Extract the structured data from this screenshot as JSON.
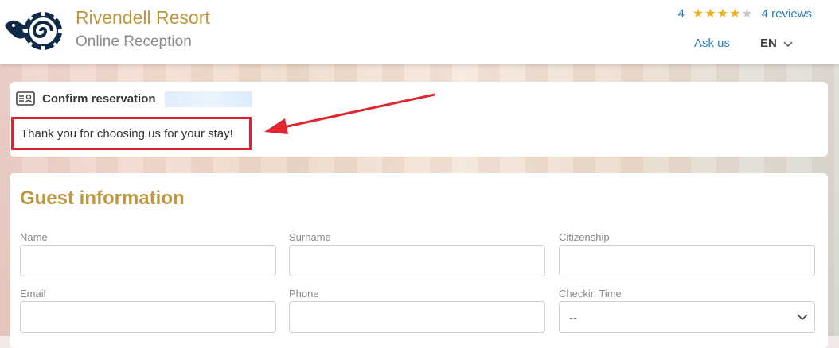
{
  "header": {
    "hotel_name": "Rivendell Resort",
    "subtitle": "Online Reception",
    "rating": "4",
    "stars_filled": 4,
    "stars_total": 5,
    "reviews_link": "4 reviews",
    "ask_us": "Ask us",
    "language": "EN",
    "logo_icon": "spiral-bird-logo-icon"
  },
  "confirm": {
    "title": "Confirm reservation",
    "message": "Thank you for choosing us for your stay!"
  },
  "guest": {
    "title": "Guest information",
    "fields": {
      "name_label": "Name",
      "surname_label": "Surname",
      "citizenship_label": "Citizenship",
      "email_label": "Email",
      "phone_label": "Phone",
      "checkin_label": "Checkin Time",
      "checkin_value": "--"
    }
  },
  "colors": {
    "brand_gold": "#c1973e",
    "link_blue": "#2a7fc1",
    "annotation_red": "#e02531",
    "star": "#f0b21a"
  }
}
